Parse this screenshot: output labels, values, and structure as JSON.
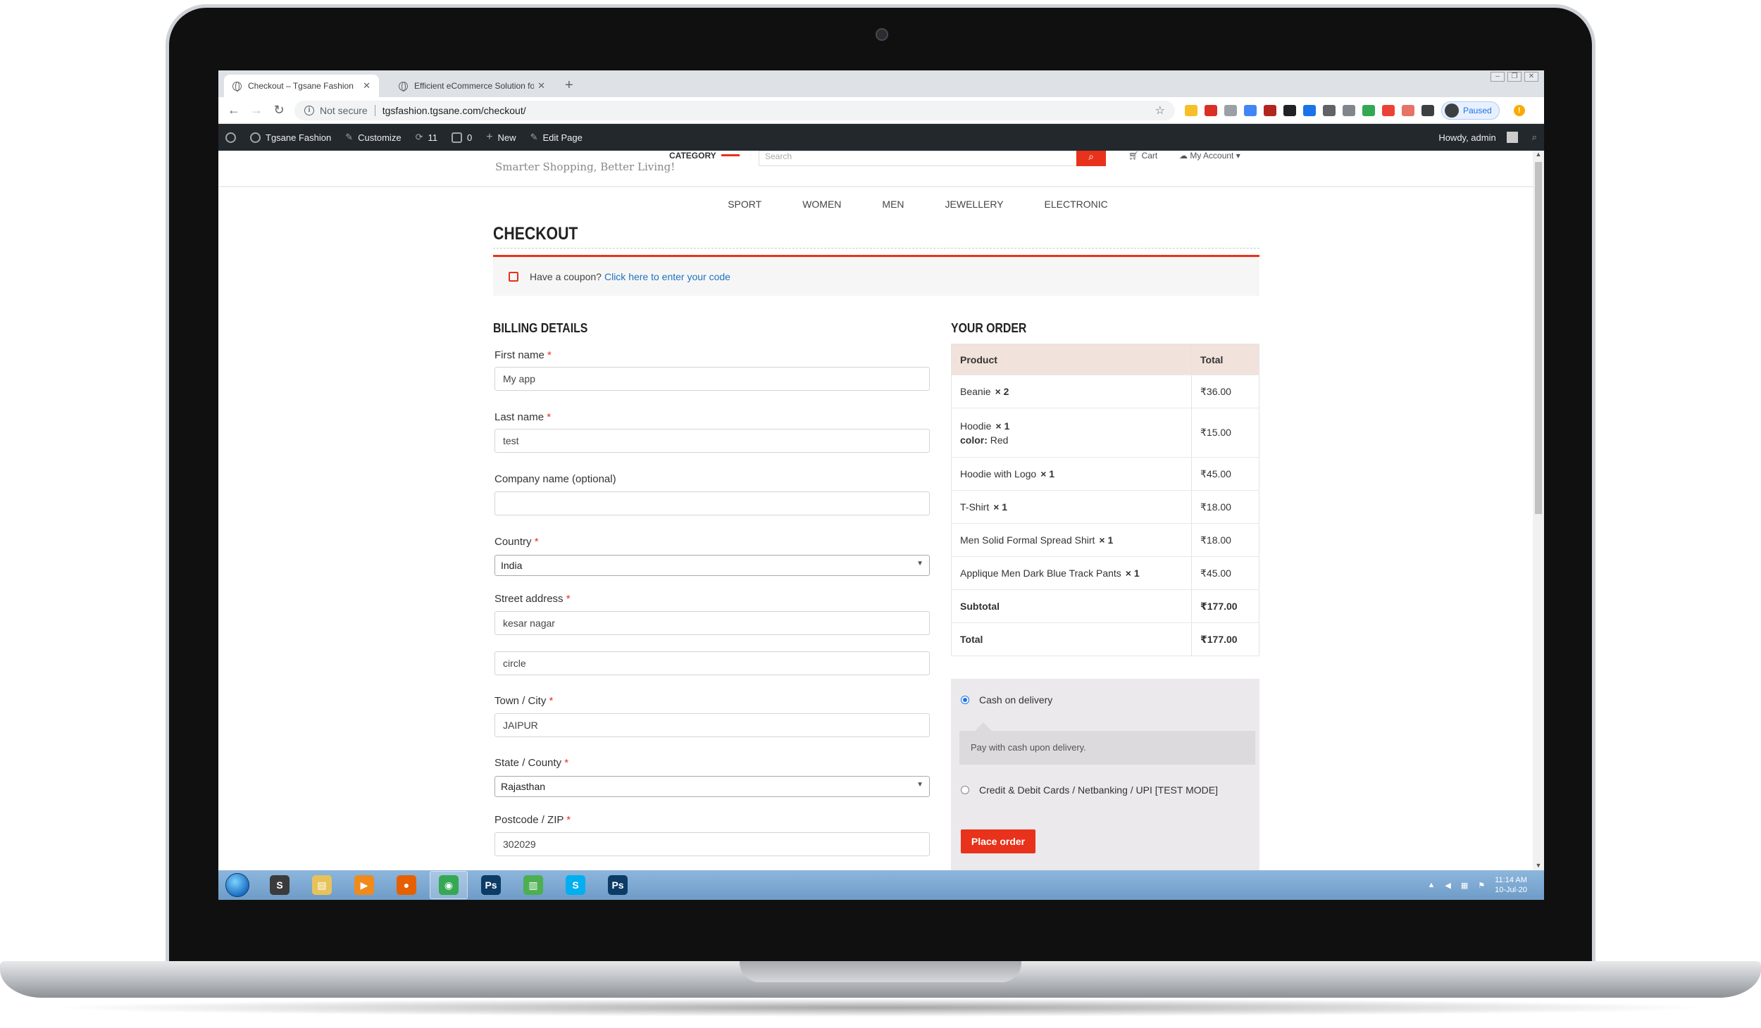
{
  "browser": {
    "tabs": [
      {
        "label": "Checkout – Tgsane Fashion",
        "active": true
      },
      {
        "label": "Efficient eCommerce Solution fo",
        "active": false
      }
    ],
    "new_tab": "+",
    "url": "tgsfashion.tgsane.com/checkout/",
    "security_label": "Not secure",
    "profile_status": "Paused"
  },
  "adminbar": {
    "site_name": "Tgsane Fashion",
    "customize": "Customize",
    "updates_count": "11",
    "comments_count": "0",
    "new": "New",
    "edit_page": "Edit Page",
    "howdy": "Howdy, admin"
  },
  "header": {
    "tagline": "Smarter Shopping, Better Living!",
    "category_label": "CATEGORY",
    "search_placeholder": "Search",
    "cart_label": "Cart",
    "account_label": "My Account"
  },
  "nav": [
    "SPORT",
    "WOMEN",
    "MEN",
    "JEWELLERY",
    "ELECTRONIC"
  ],
  "checkout": {
    "title": "CHECKOUT",
    "coupon_text": "Have a coupon?",
    "coupon_link": "Click here to enter your code",
    "billing_heading": "BILLING DETAILS",
    "fields": {
      "first_name": {
        "label": "First name",
        "value": "My app"
      },
      "last_name": {
        "label": "Last name",
        "value": "test"
      },
      "company": {
        "label": "Company name (optional)",
        "value": ""
      },
      "country": {
        "label": "Country",
        "value": "India"
      },
      "street": {
        "label": "Street address",
        "value": "kesar nagar",
        "value2": "circle"
      },
      "city": {
        "label": "Town / City",
        "value": "JAIPUR"
      },
      "state": {
        "label": "State / County",
        "value": "Rajasthan"
      },
      "postcode": {
        "label": "Postcode / ZIP",
        "value": "302029"
      }
    },
    "required_mark": "*"
  },
  "order": {
    "heading": "YOUR ORDER",
    "col_product": "Product",
    "col_total": "Total",
    "items": [
      {
        "name": "Beanie",
        "qty": "× 2",
        "total": "₹36.00"
      },
      {
        "name": "Hoodie",
        "qty": "× 1",
        "meta_key": "color:",
        "meta_value": "Red",
        "total": "₹15.00"
      },
      {
        "name": "Hoodie with Logo",
        "qty": "× 1",
        "total": "₹45.00"
      },
      {
        "name": "T-Shirt",
        "qty": "× 1",
        "total": "₹18.00"
      },
      {
        "name": "Men Solid Formal Spread Shirt",
        "qty": "× 1",
        "total": "₹18.00"
      },
      {
        "name": "Applique Men Dark Blue Track Pants",
        "qty": "× 1",
        "total": "₹45.00"
      }
    ],
    "subtotal_label": "Subtotal",
    "subtotal": "₹177.00",
    "total_label": "Total",
    "total": "₹177.00"
  },
  "payment": {
    "cod_label": "Cash on delivery",
    "cod_desc": "Pay with cash upon delivery.",
    "card_label": "Credit & Debit Cards / Netbanking / UPI [TEST MODE]",
    "place_order": "Place order"
  },
  "taskbar": {
    "time": "11:14 AM",
    "date": "10-Jul-20",
    "apps": [
      {
        "name": "sublime",
        "glyph": "S",
        "color": "#3b3b3b"
      },
      {
        "name": "explorer",
        "glyph": "▤",
        "color": "#e6c35a"
      },
      {
        "name": "media-player",
        "glyph": "▶",
        "color": "#f08a1c"
      },
      {
        "name": "firefox",
        "glyph": "●",
        "color": "#e66000"
      },
      {
        "name": "chrome",
        "glyph": "◉",
        "color": "#34a853"
      },
      {
        "name": "photoshop-1",
        "glyph": "Ps",
        "color": "#0b3b66"
      },
      {
        "name": "monitor",
        "glyph": "▥",
        "color": "#4caf50"
      },
      {
        "name": "skype",
        "glyph": "S",
        "color": "#00aff0"
      },
      {
        "name": "photoshop-2",
        "glyph": "Ps",
        "color": "#0b3b66"
      }
    ]
  },
  "colors": {
    "accent": "#e8321b",
    "link": "#1e73be",
    "table_header": "#f2e2dc"
  }
}
